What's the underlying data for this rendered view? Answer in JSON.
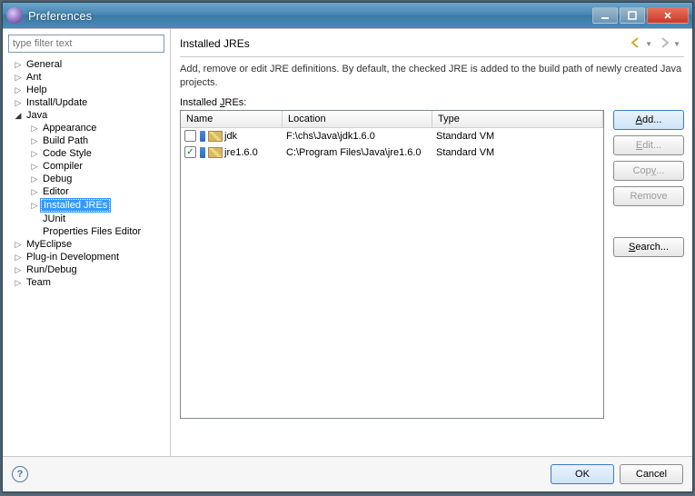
{
  "window": {
    "title": "Preferences"
  },
  "filter": {
    "placeholder": "type filter text"
  },
  "tree": [
    {
      "label": "General",
      "level": 0,
      "expanded": false,
      "hasChildren": true,
      "selected": false
    },
    {
      "label": "Ant",
      "level": 0,
      "expanded": false,
      "hasChildren": true,
      "selected": false
    },
    {
      "label": "Help",
      "level": 0,
      "expanded": false,
      "hasChildren": true,
      "selected": false
    },
    {
      "label": "Install/Update",
      "level": 0,
      "expanded": false,
      "hasChildren": true,
      "selected": false
    },
    {
      "label": "Java",
      "level": 0,
      "expanded": true,
      "hasChildren": true,
      "selected": false
    },
    {
      "label": "Appearance",
      "level": 1,
      "expanded": false,
      "hasChildren": true,
      "selected": false
    },
    {
      "label": "Build Path",
      "level": 1,
      "expanded": false,
      "hasChildren": true,
      "selected": false
    },
    {
      "label": "Code Style",
      "level": 1,
      "expanded": false,
      "hasChildren": true,
      "selected": false
    },
    {
      "label": "Compiler",
      "level": 1,
      "expanded": false,
      "hasChildren": true,
      "selected": false
    },
    {
      "label": "Debug",
      "level": 1,
      "expanded": false,
      "hasChildren": true,
      "selected": false
    },
    {
      "label": "Editor",
      "level": 1,
      "expanded": false,
      "hasChildren": true,
      "selected": false
    },
    {
      "label": "Installed JREs",
      "level": 1,
      "expanded": false,
      "hasChildren": true,
      "selected": true
    },
    {
      "label": "JUnit",
      "level": 1,
      "expanded": false,
      "hasChildren": false,
      "selected": false
    },
    {
      "label": "Properties Files Editor",
      "level": 1,
      "expanded": false,
      "hasChildren": false,
      "selected": false
    },
    {
      "label": "MyEclipse",
      "level": 0,
      "expanded": false,
      "hasChildren": true,
      "selected": false
    },
    {
      "label": "Plug-in Development",
      "level": 0,
      "expanded": false,
      "hasChildren": true,
      "selected": false
    },
    {
      "label": "Run/Debug",
      "level": 0,
      "expanded": false,
      "hasChildren": true,
      "selected": false
    },
    {
      "label": "Team",
      "level": 0,
      "expanded": false,
      "hasChildren": true,
      "selected": false
    }
  ],
  "page": {
    "title": "Installed JREs",
    "description": "Add, remove or edit JRE definitions. By default, the checked JRE is added to the build path of newly created Java projects.",
    "list_label_pre": "Installed ",
    "list_label_mn": "J",
    "list_label_post": "REs:"
  },
  "table": {
    "columns": {
      "name": "Name",
      "location": "Location",
      "type": "Type"
    },
    "rows": [
      {
        "checked": false,
        "name": "jdk",
        "location": "F:\\chs\\Java\\jdk1.6.0",
        "type": "Standard VM"
      },
      {
        "checked": true,
        "name": "jre1.6.0",
        "location": "C:\\Program Files\\Java\\jre1.6.0",
        "type": "Standard VM"
      }
    ]
  },
  "buttons": {
    "add_mn": "A",
    "add_post": "dd...",
    "edit_mn": "E",
    "edit_post": "dit...",
    "copy_pre": "Cop",
    "copy_mn": "y",
    "copy_post": "...",
    "remove": "Remove",
    "search_mn": "S",
    "search_post": "earch..."
  },
  "footer": {
    "ok": "OK",
    "cancel": "Cancel"
  }
}
